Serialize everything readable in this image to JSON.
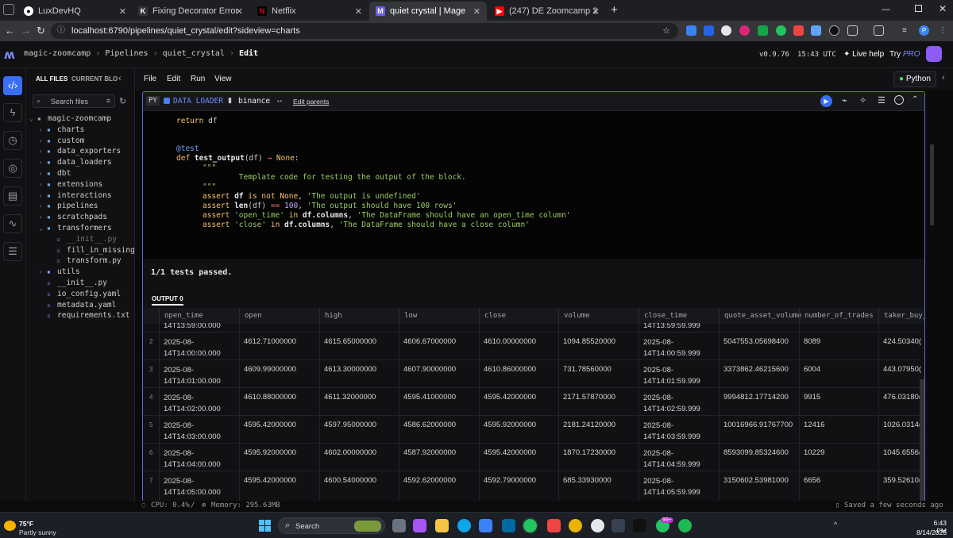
{
  "browser": {
    "tabs": [
      {
        "title": "LuxDevHQ",
        "icon": "github-icon"
      },
      {
        "title": "Fixing Decorator Error in Binan",
        "icon": "k-icon"
      },
      {
        "title": "Netflix",
        "icon": "netflix-icon"
      },
      {
        "title": "quiet crystal | Mage",
        "icon": "mage-icon"
      },
      {
        "title": "(247) DE Zoomcamp 2.2.2 - A S",
        "icon": "youtube-icon"
      }
    ],
    "new_tab": "+",
    "url": "localhost:6790/pipelines/quiet_crystal/edit?sideview=charts"
  },
  "app": {
    "breadcrumb": [
      "magic-zoomcamp",
      "Pipelines",
      "quiet_crystal",
      "Edit"
    ],
    "version": "v0.9.76",
    "time": "15:43 UTC",
    "live_help": "Live help",
    "try_label": "Try",
    "try_pro": "PRO"
  },
  "files": {
    "tab_all": "ALL FILES",
    "tab_current": "CURRENT BLOCK",
    "search_placeholder": "Search files",
    "tree": [
      {
        "name": "magic-zoomcamp",
        "level": 0,
        "type": "root"
      },
      {
        "name": "charts",
        "level": 1,
        "type": "folder"
      },
      {
        "name": "custom",
        "level": 1,
        "type": "folder"
      },
      {
        "name": "data_exporters",
        "level": 1,
        "type": "folder"
      },
      {
        "name": "data_loaders",
        "level": 1,
        "type": "folder"
      },
      {
        "name": "dbt",
        "level": 1,
        "type": "folder"
      },
      {
        "name": "extensions",
        "level": 1,
        "type": "folder"
      },
      {
        "name": "interactions",
        "level": 1,
        "type": "folder"
      },
      {
        "name": "pipelines",
        "level": 1,
        "type": "folder"
      },
      {
        "name": "scratchpads",
        "level": 1,
        "type": "folder"
      },
      {
        "name": "transformers",
        "level": 1,
        "type": "folder-open"
      },
      {
        "name": "__init__.py",
        "level": 2,
        "type": "file-dim"
      },
      {
        "name": "fill_in_missing_va",
        "level": 2,
        "type": "file"
      },
      {
        "name": "transform.py",
        "level": 2,
        "type": "file"
      },
      {
        "name": "utils",
        "level": 1,
        "type": "folder"
      },
      {
        "name": "__init__.py",
        "level": 1,
        "type": "file"
      },
      {
        "name": "io_config.yaml",
        "level": 1,
        "type": "file"
      },
      {
        "name": "metadata.yaml",
        "level": 1,
        "type": "file"
      },
      {
        "name": "requirements.txt",
        "level": 1,
        "type": "file"
      }
    ]
  },
  "menu": [
    "File",
    "Edit",
    "Run",
    "View"
  ],
  "kernel": "Python",
  "block": {
    "lang": "PY",
    "type": "DATA LOADER",
    "name": "binance",
    "edit_parents": "Edit parents"
  },
  "code": [
    "        return df",
    "",
    "",
    "    @test",
    "    def test_output(df) -> None:",
    "        \"\"\"",
    "        Template code for testing the output of the block.",
    "        \"\"\"",
    "        assert df is not None, 'The output is undefined'",
    "        assert len(df) == 100, 'The output should have 100 rows'",
    "        assert 'open_time' in df.columns, 'The DataFrame should have an open_time column'",
    "        assert 'close' in df.columns, 'The DataFrame should have a close column'"
  ],
  "tests_result": "1/1 tests passed.",
  "output_label": "OUTPUT 0",
  "table": {
    "columns": [
      "open_time",
      "open",
      "high",
      "low",
      "close",
      "volume",
      "close_time",
      "quote_asset_volume",
      "number_of_trades",
      "taker_buy_b"
    ],
    "partial_row": [
      "14T13:59:00.000",
      "",
      "",
      "",
      "",
      "",
      "14T13:59:59.999",
      "",
      "",
      ""
    ],
    "rows": [
      {
        "idx": "2",
        "cells": [
          "2025-08-\n14T14:00:00.000",
          "4612.71000000",
          "4615.65000000",
          "4606.67000000",
          "4610.00000000",
          "1094.85520000",
          "2025-08-\n14T14:00:59.999",
          "5047553.05698400",
          "8089",
          "424.50340("
        ]
      },
      {
        "idx": "3",
        "cells": [
          "2025-08-\n14T14:01:00.000",
          "4609.99000000",
          "4613.30000000",
          "4607.90000000",
          "4610.86000000",
          "731.78560000",
          "2025-08-\n14T14:01:59.999",
          "3373862.46215600",
          "6004",
          "443.07950("
        ]
      },
      {
        "idx": "4",
        "cells": [
          "2025-08-\n14T14:02:00.000",
          "4610.88000000",
          "4611.32000000",
          "4595.41000000",
          "4595.42000000",
          "2171.57870000",
          "2025-08-\n14T14:02:59.999",
          "9994812.17714200",
          "9915",
          "476.03180("
        ]
      },
      {
        "idx": "5",
        "cells": [
          "2025-08-\n14T14:03:00.000",
          "4595.42000000",
          "4597.95000000",
          "4586.62000000",
          "4595.92000000",
          "2181.24120000",
          "2025-08-\n14T14:03:59.999",
          "10016966.91767700",
          "12416",
          "1026.0314("
        ]
      },
      {
        "idx": "6",
        "cells": [
          "2025-08-\n14T14:04:00.000",
          "4595.92000000",
          "4602.00000000",
          "4587.92000000",
          "4595.42000000",
          "1870.17230000",
          "2025-08-\n14T14:04:59.999",
          "8593099.85324600",
          "10229",
          "1045.6556("
        ]
      },
      {
        "idx": "7",
        "cells": [
          "2025-08-\n14T14:05:00.000",
          "4595.42000000",
          "4600.54000000",
          "4592.62000000",
          "4592.79000000",
          "685.33930000",
          "2025-08-\n14T14:05:59.999",
          "3150602.53981000",
          "6656",
          "359.52610("
        ]
      }
    ]
  },
  "status": {
    "cpu": "CPU: 0.4%",
    "sep": "/",
    "memory": "Memory: 295.63MB",
    "saved": "Saved a few seconds ago"
  },
  "taskbar": {
    "weather_temp": "75°F",
    "weather_desc": "Partly sunny",
    "search": "Search",
    "badge": "99+",
    "time": "6:43 PM",
    "date": "8/14/2025"
  },
  "colors": {
    "accent": "#5c6bd6",
    "loader_blue": "#4c7cf0",
    "kernel_green": "#5bd66b"
  }
}
